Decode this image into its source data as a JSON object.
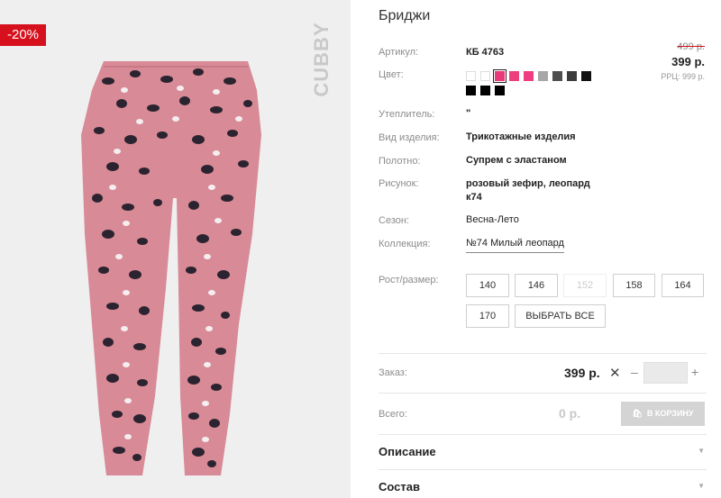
{
  "gallery": {
    "discount_badge": "-20%",
    "brand": "CUBBY"
  },
  "product": {
    "title": "Бриджи",
    "old_price": "499 р.",
    "price": "399 р.",
    "rrc": "РРЦ: 999 р.",
    "attributes": {
      "article_label": "Артикул:",
      "article_value": "КБ 4763",
      "color_label": "Цвет:",
      "insulation_label": "Утеплитель:",
      "insulation_value": "\"",
      "type_label": "Вид изделия:",
      "type_value": "Трикотажные изделия",
      "fabric_label": "Полотно:",
      "fabric_value": "Супрем с эластаном",
      "pattern_label": "Рисунок:",
      "pattern_value_line1": "розовый зефир, леопард",
      "pattern_value_line2": "к74",
      "season_label": "Сезон:",
      "season_value": "Весна-Лето",
      "collection_label": "Коллекция:",
      "collection_value": "№74 Милый леопард"
    },
    "color_swatches": [
      {
        "name": "white-1",
        "color": "#ffffff",
        "active": false
      },
      {
        "name": "white-2",
        "color": "#ffffff",
        "active": false
      },
      {
        "name": "pink-1",
        "color": "#e8397a",
        "active": true
      },
      {
        "name": "pink-2",
        "color": "#ec3f7b",
        "active": false
      },
      {
        "name": "pink-3",
        "color": "#ee3d80",
        "active": false
      },
      {
        "name": "grey-1",
        "color": "#a7a7a7",
        "active": false
      },
      {
        "name": "grey-2",
        "color": "#4f4f4f",
        "active": false
      },
      {
        "name": "grey-3",
        "color": "#3c3c3c",
        "active": false
      },
      {
        "name": "black-1",
        "color": "#111111",
        "active": false
      },
      {
        "name": "black-2",
        "color": "#000000",
        "active": false
      },
      {
        "name": "black-3",
        "color": "#000000",
        "active": false
      },
      {
        "name": "black-4",
        "color": "#000000",
        "active": false
      }
    ],
    "size_label": "Рост/размер:",
    "sizes": [
      {
        "label": "140",
        "disabled": false
      },
      {
        "label": "146",
        "disabled": false
      },
      {
        "label": "152",
        "disabled": true
      },
      {
        "label": "158",
        "disabled": false
      },
      {
        "label": "164",
        "disabled": false
      },
      {
        "label": "170",
        "disabled": false
      }
    ],
    "select_all_label": "ВЫБРАТЬ ВСЕ"
  },
  "order": {
    "label": "Заказ:",
    "price": "399 р.",
    "times": "✕",
    "minus": "–",
    "plus": "+",
    "qty_value": ""
  },
  "total": {
    "label": "Всего:",
    "value": "0 р.",
    "cart_button": "В КОРЗИНУ"
  },
  "accordion": {
    "description": "Описание",
    "composition": "Состав"
  },
  "colors": {
    "accent": "#d6101c",
    "pants_pink": "#d88a96"
  }
}
